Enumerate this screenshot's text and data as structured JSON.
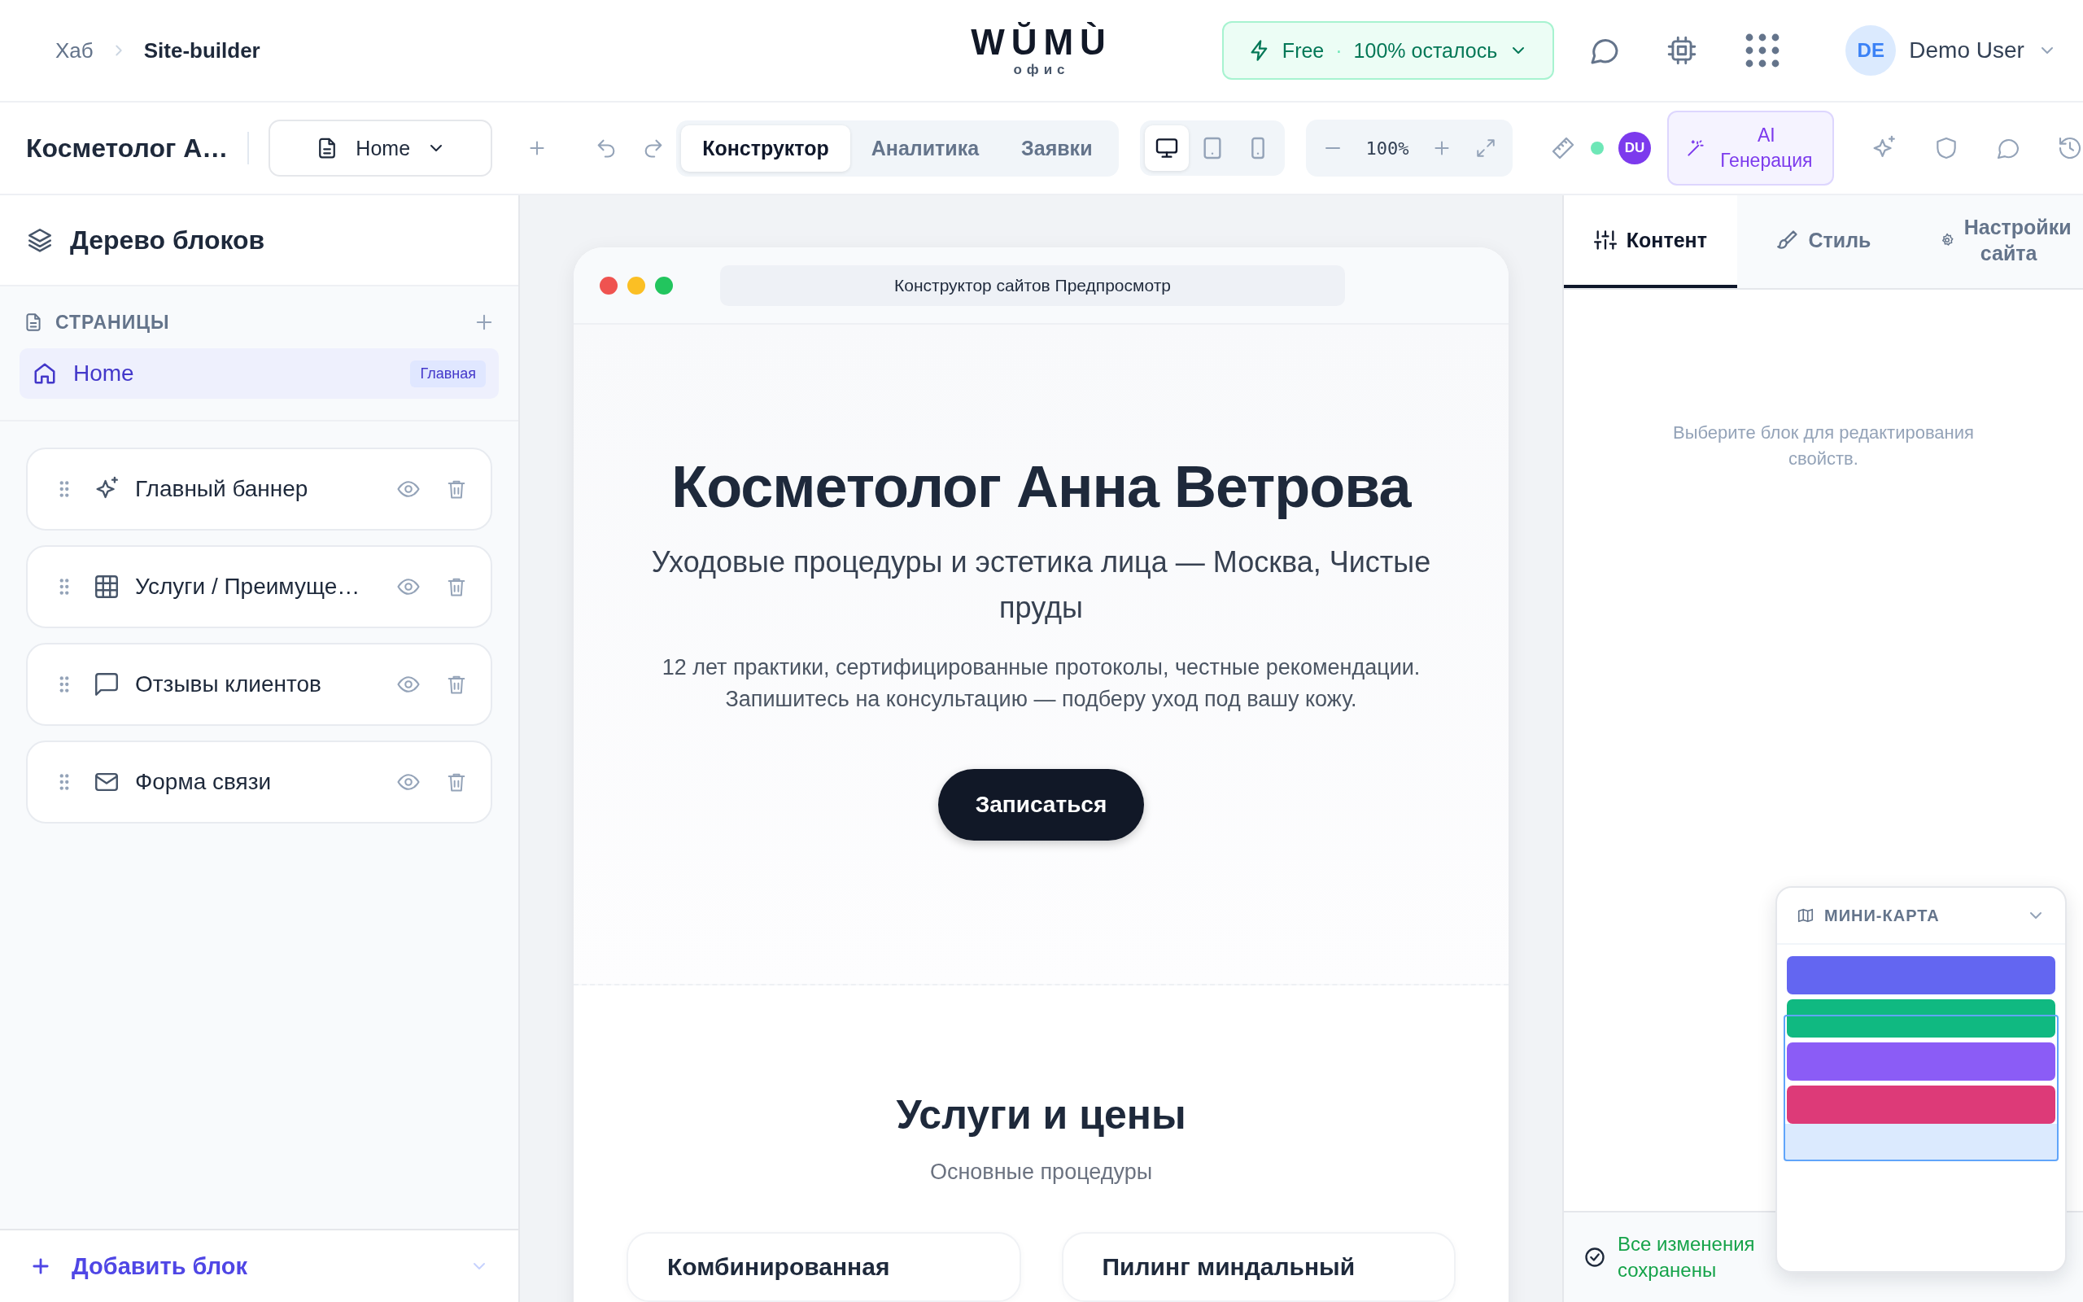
{
  "header": {
    "breadcrumbs": [
      {
        "label": "Хаб",
        "current": false
      },
      {
        "label": "Site-builder",
        "current": true
      }
    ],
    "logo": {
      "wordmark": "WŬMÙ",
      "subtitle": "офис"
    },
    "plan": {
      "name": "Free",
      "separator": "·",
      "remaining": "100% осталось"
    },
    "user": {
      "initials": "DE",
      "name": "Demo User"
    }
  },
  "toolbar": {
    "site_title": "Косметолог А…",
    "page_select": "Home",
    "view_tabs": [
      {
        "label": "Конструктор",
        "selected": true
      },
      {
        "label": "Аналитика",
        "selected": false
      },
      {
        "label": "Заявки",
        "selected": false
      }
    ],
    "devices": [
      {
        "kind": "desktop",
        "selected": true
      },
      {
        "kind": "tablet",
        "selected": false
      },
      {
        "kind": "mobile",
        "selected": false
      }
    ],
    "zoom": "100%",
    "online": true,
    "collaborator": "DU",
    "ai_button": "AI Генерация"
  },
  "left_panel": {
    "title": "Дерево блоков",
    "pages_heading": "СТРАНИЦЫ",
    "pages": [
      {
        "name": "Home",
        "badge": "Главная",
        "selected": true
      }
    ],
    "blocks": [
      {
        "kind": "hero",
        "label": "Главный баннер"
      },
      {
        "kind": "features",
        "label": "Услуги / Преимуще…"
      },
      {
        "kind": "testimonials",
        "label": "Отзывы клиентов"
      },
      {
        "kind": "contact",
        "label": "Форма связи"
      }
    ],
    "add_block": "Добавить блок"
  },
  "preview": {
    "address": "Конструктор сайтов Предпросмотр",
    "hero": {
      "title": "Косметолог Анна Ветрова",
      "subtitle": "Уходовые процедуры и эстетика лица — Москва, Чистые пруды",
      "text": "12 лет практики, сертифицированные протоколы, честные рекомендации. Запишитесь на консультацию — подберу уход под вашу кожу.",
      "button": "Записаться"
    },
    "services": {
      "title": "Услуги и цены",
      "subtitle": "Основные процедуры",
      "cards": [
        {
          "title": "Комбинированная"
        },
        {
          "title": "Пилинг миндальный"
        }
      ]
    }
  },
  "right_panel": {
    "tabs": [
      {
        "kind": "content",
        "label": "Контент",
        "selected": true
      },
      {
        "kind": "style",
        "label": "Стиль",
        "selected": false
      },
      {
        "kind": "settings",
        "label": "Настройки сайта",
        "selected": false
      }
    ],
    "empty_hint": "Выберите блок для редактирования свойств.",
    "save_status": "Все изменения сохранены",
    "minimap": {
      "title": "МИНИ-КАРТА",
      "blocks": [
        {
          "color": "#6366f1"
        },
        {
          "color": "#10b981"
        },
        {
          "color": "#8b5cf6"
        },
        {
          "color": "#dd3a78"
        }
      ]
    }
  }
}
